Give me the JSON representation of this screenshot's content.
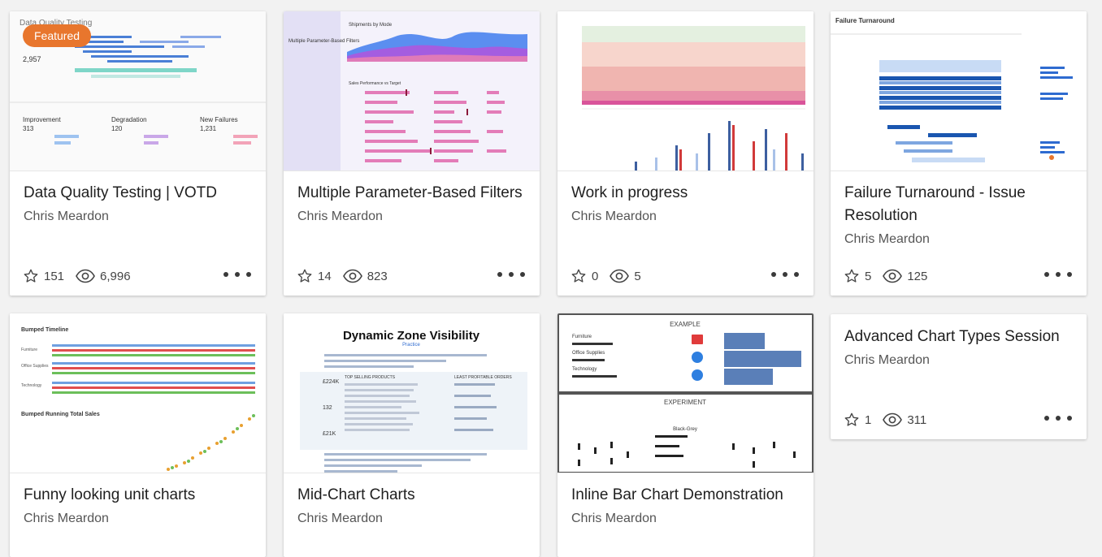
{
  "badge": {
    "featured": "Featured"
  },
  "cards": [
    {
      "title": "Data Quality Testing | VOTD",
      "author": "Chris Meardon",
      "favorites": "151",
      "views": "6,996",
      "thumb_texts": {
        "t1": "Data Quality Testing",
        "t2": "2,957",
        "t3": "Improvement",
        "t4": "Degradation",
        "t5": "New Failures",
        "t6": "313",
        "t7": "120",
        "t8": "1,231"
      }
    },
    {
      "title": "Multiple Parameter-Based Filters",
      "author": "Chris Meardon",
      "favorites": "14",
      "views": "823",
      "thumb_texts": {
        "t1": "Multiple Parameter-Based Filters",
        "t2": "Shipments by Mode",
        "t3": "Sales Performance vs Target"
      }
    },
    {
      "title": "Work in progress",
      "author": "Chris Meardon",
      "favorites": "0",
      "views": "5"
    },
    {
      "title": "Failure Turnaround - Issue Resolution",
      "author": "Chris Meardon",
      "favorites": "5",
      "views": "125",
      "thumb_texts": {
        "t1": "Failure Turnaround"
      }
    },
    {
      "title": "Funny looking unit charts",
      "author": "Chris Meardon",
      "thumb_texts": {
        "t1": "Bumped Timeline",
        "t2": "Bumped Running Total Sales",
        "t3": "Furniture",
        "t4": "Office Supplies",
        "t5": "Technology"
      }
    },
    {
      "title": "Mid-Chart Charts",
      "author": "Chris Meardon",
      "thumb_texts": {
        "t1": "Dynamic Zone Visibility",
        "t2": "Practice",
        "t3": "TOP SELLING PRODUCTS",
        "t4": "LEAST PROFITABLE ORDERS",
        "t5": "£224K",
        "t6": "132",
        "t7": "£21K"
      }
    },
    {
      "title": "Inline Bar Chart Demonstration",
      "author": "Chris Meardon",
      "thumb_texts": {
        "t1": "EXAMPLE",
        "t2": "EXPERIMENT",
        "t3": "Furniture",
        "t4": "Office Supplies",
        "t5": "Technology",
        "t6": "Black-Grey"
      }
    },
    {
      "title": "Advanced Chart Types Session",
      "author": "Chris Meardon",
      "favorites": "1",
      "views": "311"
    }
  ],
  "icons": {
    "favorite": "star-icon",
    "views": "eye-icon",
    "more": "more-options-icon"
  },
  "colors": {
    "badge": "#e8762d",
    "background": "#f2f2f2"
  }
}
